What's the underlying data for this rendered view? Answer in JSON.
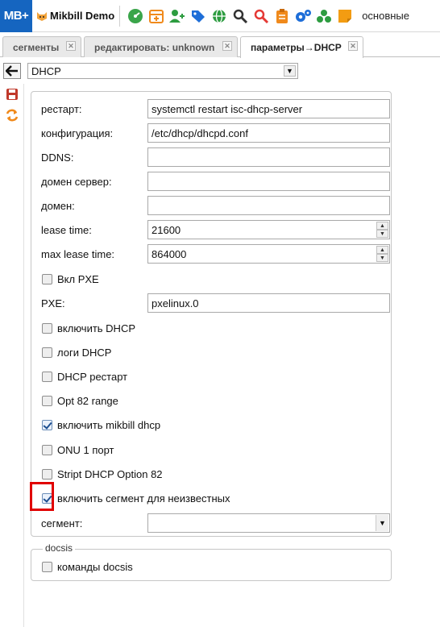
{
  "app": {
    "logo": "MB+",
    "brand": "Mikbill Demo",
    "menu_text": "основные",
    "tools": [
      "speedometer-icon",
      "calendar-icon",
      "add-user-icon",
      "tags-icon",
      "globe-icon",
      "search-icon",
      "search-red-icon",
      "clipboard-icon",
      "gears-icon",
      "recycle-icon",
      "sticky-note-icon"
    ]
  },
  "tabs": [
    {
      "label": "сегменты",
      "active": false
    },
    {
      "label": "редактировать: unknown",
      "active": false
    },
    {
      "label": "параметры→DHCP",
      "active": true
    }
  ],
  "module_select": {
    "value": "DHCP"
  },
  "form": {
    "restart": {
      "label": "рестарт:",
      "value": "systemctl restart isc-dhcp-server"
    },
    "config": {
      "label": "конфигурация:",
      "value": "/etc/dhcp/dhcpd.conf"
    },
    "ddns": {
      "label": "DDNS:",
      "value": ""
    },
    "domain_server": {
      "label": "домен сервер:",
      "value": ""
    },
    "domain": {
      "label": "домен:",
      "value": ""
    },
    "lease_time": {
      "label": "lease time:",
      "value": "21600"
    },
    "max_lease_time": {
      "label": "max lease time:",
      "value": "864000"
    },
    "pxe_enable": {
      "label": "Вкл PXE",
      "checked": false
    },
    "pxe": {
      "label": "PXE:",
      "value": "pxelinux.0"
    },
    "dhcp_enable": {
      "label": "включить DHCP",
      "checked": false
    },
    "dhcp_logs": {
      "label": "логи DHCP",
      "checked": false
    },
    "dhcp_restart": {
      "label": "DHCP рестарт",
      "checked": false
    },
    "opt82_range": {
      "label": "Opt 82 range",
      "checked": false
    },
    "mikbill_dhcp": {
      "label": "включить mikbill dhcp",
      "checked": true
    },
    "onu_one_port": {
      "label": "ONU 1 порт",
      "checked": false
    },
    "strip_opt82": {
      "label": "Stript DHCP Option 82",
      "checked": false
    },
    "unknown_segment": {
      "label": "включить сегмент для неизвестных",
      "checked": true
    },
    "segment": {
      "label": "сегмент:",
      "value": ""
    }
  },
  "docsis": {
    "legend": "docsis",
    "commands": {
      "label": "команды docsis",
      "checked": false
    }
  }
}
